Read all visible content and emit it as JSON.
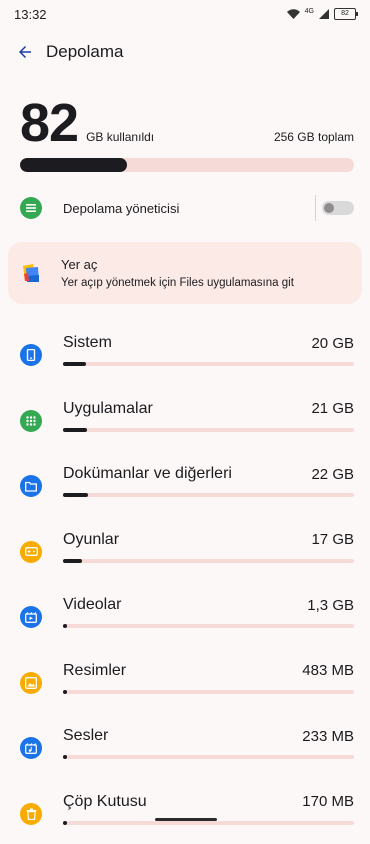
{
  "status": {
    "time": "13:32",
    "network": "4G",
    "battery": "82"
  },
  "appbar": {
    "title": "Depolama"
  },
  "usage": {
    "used_number": "82",
    "used_label": "GB kullanıldı",
    "total_label": "256 GB toplam",
    "used_fraction": 0.32
  },
  "manager": {
    "label": "Depolama yöneticisi",
    "enabled": false
  },
  "free_up": {
    "title": "Yer aç",
    "subtitle": "Yer açıp yönetmek için Files uygulamasına git"
  },
  "categories": [
    {
      "name": "Sistem",
      "size": "20 GB",
      "fraction": 0.078,
      "icon": "phone-icon",
      "color": "#1a73e8"
    },
    {
      "name": "Uygulamalar",
      "size": "21 GB",
      "fraction": 0.082,
      "icon": "apps-grid-icon",
      "color": "#34a853"
    },
    {
      "name": "Dokümanlar ve diğerleri",
      "size": "22 GB",
      "fraction": 0.086,
      "icon": "folder-icon",
      "color": "#1a73e8"
    },
    {
      "name": "Oyunlar",
      "size": "17 GB",
      "fraction": 0.066,
      "icon": "gamepad-icon",
      "color": "#f9ab00"
    },
    {
      "name": "Videolar",
      "size": "1,3 GB",
      "fraction": 0.005,
      "icon": "video-icon",
      "color": "#1a73e8"
    },
    {
      "name": "Resimler",
      "size": "483 MB",
      "fraction": 0.002,
      "icon": "image-icon",
      "color": "#f9ab00"
    },
    {
      "name": "Sesler",
      "size": "233 MB",
      "fraction": 0.001,
      "icon": "audio-icon",
      "color": "#1a73e8"
    },
    {
      "name": "Çöp Kutusu",
      "size": "170 MB",
      "fraction": 0.001,
      "icon": "trash-icon",
      "color": "#f9ab00"
    }
  ]
}
